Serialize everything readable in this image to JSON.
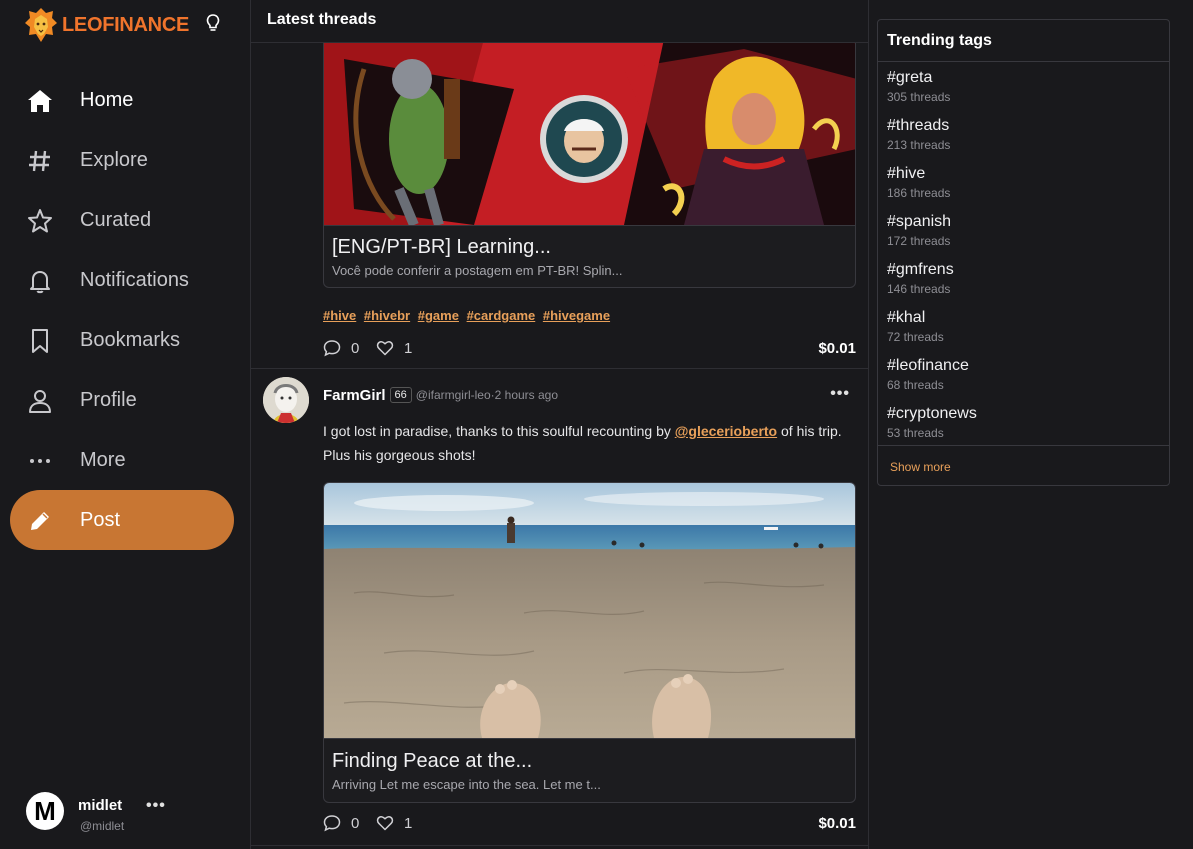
{
  "brand": {
    "name": "LEOFINANCE",
    "accent": "#f0742c"
  },
  "nav": [
    {
      "label": "Home",
      "icon": "home-icon"
    },
    {
      "label": "Explore",
      "icon": "hash-icon"
    },
    {
      "label": "Curated",
      "icon": "star-icon"
    },
    {
      "label": "Notifications",
      "icon": "bell-icon"
    },
    {
      "label": "Bookmarks",
      "icon": "bookmark-icon"
    },
    {
      "label": "Profile",
      "icon": "user-icon"
    },
    {
      "label": "More",
      "icon": "more-icon"
    },
    {
      "label": "Post",
      "icon": "pencil-icon"
    }
  ],
  "user": {
    "initial": "M",
    "name": "midlet",
    "handle": "@midlet",
    "more": "•••"
  },
  "main": {
    "title": "Latest threads"
  },
  "thread1": {
    "card_title": "[ENG/PT-BR] Learning...",
    "card_desc": "Você pode conferir a postagem em PT-BR! Splin...",
    "tags": [
      "#hive",
      "#hivebr",
      "#game",
      "#cardgame",
      "#hivegame"
    ],
    "comments": "0",
    "likes": "1",
    "amount": "$0.01"
  },
  "thread2": {
    "author": "FarmGirl",
    "reputation": "66",
    "handle": "@ifarmgirl-leo",
    "time": "·2 hours ago",
    "more": "•••",
    "body_before": "I got lost in paradise, thanks to this soulful recounting by ",
    "mention": "@glecerioberto",
    "body_after": " of his trip. Plus his gorgeous shots!",
    "card_title": "Finding Peace at the...",
    "card_desc": "Arriving Let me escape into the sea. Let me t...",
    "comments": "0",
    "likes": "1",
    "amount": "$0.01"
  },
  "trending": {
    "title": "Trending tags",
    "tags": [
      {
        "name": "#greta",
        "count": "305 threads"
      },
      {
        "name": "#threads",
        "count": "213 threads"
      },
      {
        "name": "#hive",
        "count": "186 threads"
      },
      {
        "name": "#spanish",
        "count": "172 threads"
      },
      {
        "name": "#gmfrens",
        "count": "146 threads"
      },
      {
        "name": "#khal",
        "count": "72 threads"
      },
      {
        "name": "#leofinance",
        "count": "68 threads"
      },
      {
        "name": "#cryptonews",
        "count": "53 threads"
      }
    ],
    "show_more": "Show more"
  },
  "colors": {
    "post_button": "#c87633",
    "link": "#e8a05a",
    "background": "#19191c"
  }
}
